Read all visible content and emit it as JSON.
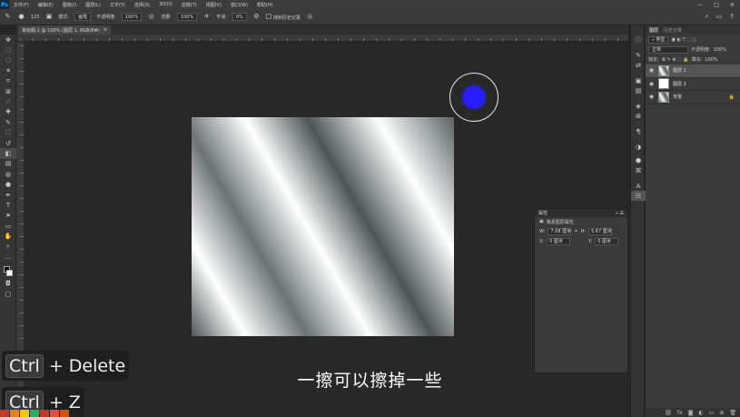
{
  "menubar": {
    "logo": "Ps",
    "items": [
      "文件(F)",
      "编辑(E)",
      "图像(I)",
      "图层(L)",
      "文字(Y)",
      "选择(S)",
      "3D(D)",
      "滤镜(T)",
      "视图(V)",
      "窗口(W)",
      "帮助(H)"
    ],
    "controls": [
      "—",
      "□",
      "✕"
    ]
  },
  "options": {
    "brush_size": "125",
    "mode_label": "模式:",
    "mode_value": "画笔",
    "opacity_label": "不透明度:",
    "opacity_value": "100%",
    "flow_label": "流量:",
    "flow_value": "100%",
    "smooth_label": "平滑:",
    "smooth_value": "0%",
    "erase_history": "抹到历史记录"
  },
  "document": {
    "tab_title": "未标题-1 @ 100% (图层 1, RGB/8#)",
    "tab_close": "×"
  },
  "subtitle": "一擦可以擦掉一些",
  "shortcuts": [
    {
      "key": "Ctrl",
      "text": "+ Delete"
    },
    {
      "key": "Ctrl",
      "text": "+ Z"
    }
  ],
  "layers_panel": {
    "tabs": [
      "图层",
      "历史记录"
    ],
    "filter_label": "类型",
    "blend_mode": "正常",
    "opacity_label": "不透明度:",
    "opacity_value": "100%",
    "lock_label": "锁定:",
    "fill_label": "填充:",
    "fill_value": "100%",
    "layers": [
      {
        "name": "图层 1",
        "selected": true
      },
      {
        "name": "图层 2",
        "selected": false
      },
      {
        "name": "背景",
        "selected": false
      }
    ]
  },
  "properties_panel": {
    "title": "属性",
    "subtitle": "像素图层属性",
    "w_label": "W:",
    "w_value": "7.08 厘米",
    "h_label": "H:",
    "h_value": "5.67 厘米",
    "x_label": "X:",
    "x_value": "0 厘米",
    "y_label": "Y:",
    "y_value": "0 厘米"
  },
  "colors": {
    "brush_cursor": "#2a1dff",
    "ps_logo": "#31a8ff"
  }
}
